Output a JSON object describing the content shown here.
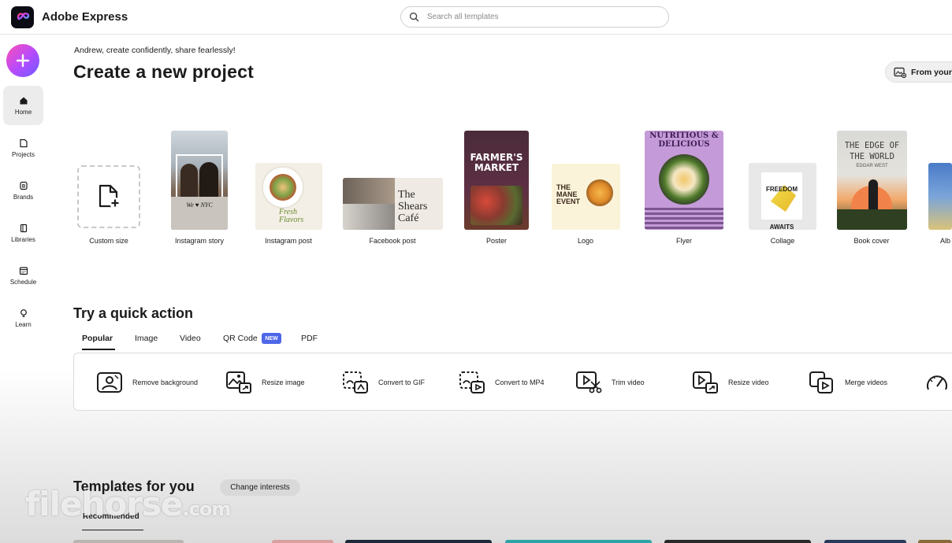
{
  "app": {
    "name": "Adobe Express",
    "brand_color": "#0c0c14"
  },
  "search": {
    "placeholder": "Search all templates"
  },
  "sidebar": {
    "items": [
      {
        "label": "Home",
        "icon": "home-icon",
        "active": true
      },
      {
        "label": "Projects",
        "icon": "projects-icon"
      },
      {
        "label": "Brands",
        "icon": "brands-icon"
      },
      {
        "label": "Libraries",
        "icon": "libraries-icon"
      },
      {
        "label": "Schedule",
        "icon": "calendar-icon"
      },
      {
        "label": "Learn",
        "icon": "lightbulb-icon"
      }
    ]
  },
  "header": {
    "greeting": "Andrew, create confidently, share fearlessly!",
    "title": "Create a new project",
    "from_button": "From your"
  },
  "projects": [
    {
      "label": "Custom size"
    },
    {
      "label": "Instagram story",
      "thumb_text": "We ♥ NYC"
    },
    {
      "label": "Instagram post",
      "thumb_text": "Fresh Flavors"
    },
    {
      "label": "Facebook post",
      "thumb_text": "The Shears Café"
    },
    {
      "label": "Poster",
      "thumb_text": "FARMER'S MARKET"
    },
    {
      "label": "Logo",
      "thumb_text": "THE MANE EVENT"
    },
    {
      "label": "Flyer",
      "thumb_text": "NUTRITIOUS & DELICIOUS"
    },
    {
      "label": "Collage",
      "thumb_text": "FREEDOM AWAITS"
    },
    {
      "label": "Book cover",
      "thumb_text": "THE EDGE OF THE WORLD",
      "thumb_subtext": "EDGAR WEST"
    },
    {
      "label": "Alb"
    }
  ],
  "quick_action": {
    "title": "Try a quick action",
    "tabs": [
      "Popular",
      "Image",
      "Video",
      "QR Code",
      "PDF"
    ],
    "active_tab": "Popular",
    "new_badge": "NEW",
    "new_badge_color": "#4e67e8",
    "actions": [
      {
        "label": "Remove background",
        "icon": "remove-background-icon"
      },
      {
        "label": "Resize image",
        "icon": "resize-image-icon"
      },
      {
        "label": "Convert to GIF",
        "icon": "convert-gif-icon"
      },
      {
        "label": "Convert to MP4",
        "icon": "convert-mp4-icon"
      },
      {
        "label": "Trim video",
        "icon": "trim-video-icon"
      },
      {
        "label": "Resize video",
        "icon": "resize-video-icon"
      },
      {
        "label": "Merge videos",
        "icon": "merge-videos-icon"
      }
    ]
  },
  "templates": {
    "title": "Templates for you",
    "change_button": "Change interests",
    "tab": "Recommended"
  },
  "watermark": {
    "text": "filehorse",
    "suffix": ".com"
  }
}
